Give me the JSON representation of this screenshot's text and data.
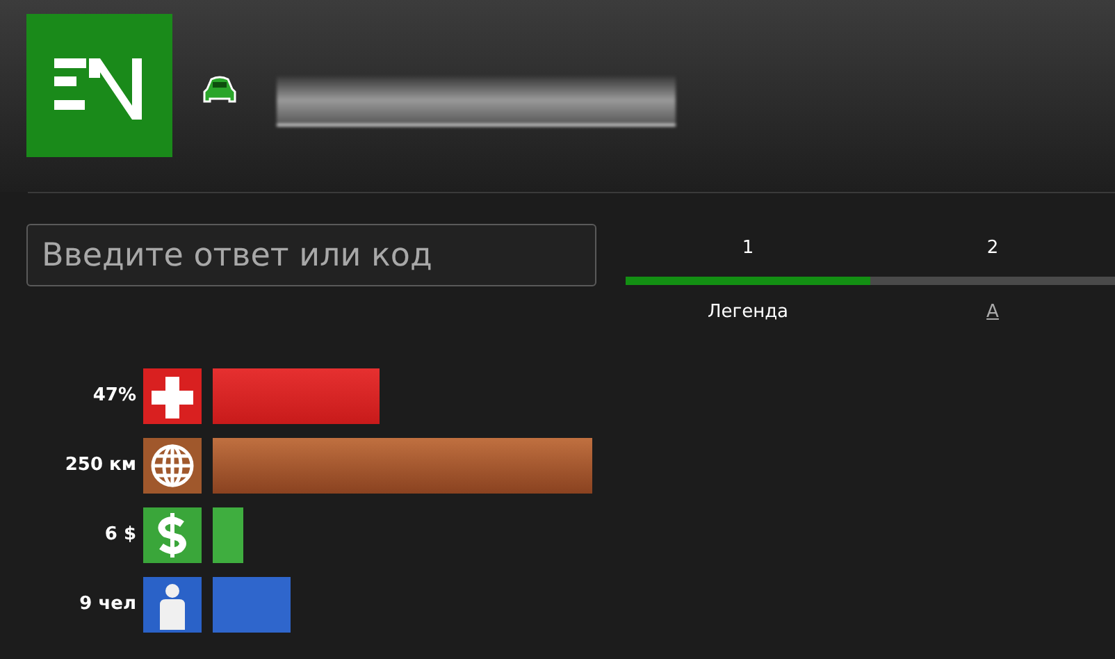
{
  "answer_field": {
    "placeholder": "Введите ответ или код"
  },
  "levels": [
    {
      "label": "1",
      "selected": true,
      "caption": "Легенда",
      "kind": "text"
    },
    {
      "label": "2",
      "selected": false,
      "caption": "А",
      "kind": "link"
    }
  ],
  "stats": [
    {
      "kind": "health",
      "reading": "47%"
    },
    {
      "kind": "distance",
      "reading": "250 км"
    },
    {
      "kind": "money",
      "reading": "6 $"
    },
    {
      "kind": "people",
      "reading": "9 чел"
    }
  ]
}
